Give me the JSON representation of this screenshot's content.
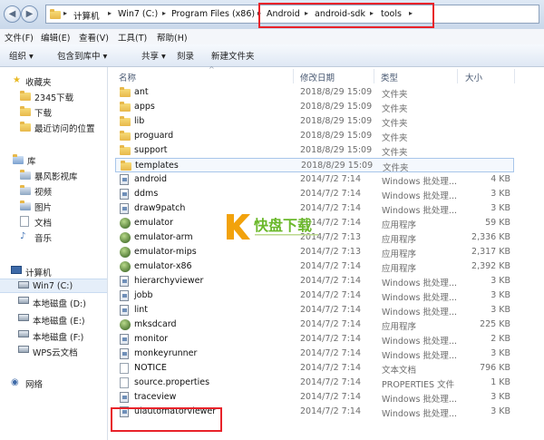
{
  "address": {
    "crumbs": [
      "计算机",
      "Win7 (C:)",
      "Program Files (x86)",
      "Android",
      "android-sdk",
      "tools"
    ]
  },
  "menu": [
    "文件(F)",
    "编辑(E)",
    "查看(V)",
    "工具(T)",
    "帮助(H)"
  ],
  "toolbar": {
    "organize": "组织 ▾",
    "include": "包含到库中 ▾",
    "share": "共享 ▾",
    "burn": "刻录",
    "new_folder": "新建文件夹"
  },
  "nav": {
    "favorites": "收藏夹",
    "fav_items": [
      "2345下载",
      "下载",
      "最近访问的位置"
    ],
    "library": "库",
    "lib_items": [
      "暴风影视库",
      "视频",
      "图片",
      "文档",
      "音乐"
    ],
    "computer": "计算机",
    "drives": [
      "Win7 (C:)",
      "本地磁盘 (D:)",
      "本地磁盘 (E:)",
      "本地磁盘 (F:)",
      "WPS云文档"
    ],
    "network": "网络"
  },
  "columns": {
    "name": "名称",
    "date": "修改日期",
    "type": "类型",
    "size": "大小"
  },
  "files": [
    {
      "name": "ant",
      "date": "2018/8/29 15:09",
      "type": "文件夹",
      "size": "",
      "icon": "folder"
    },
    {
      "name": "apps",
      "date": "2018/8/29 15:09",
      "type": "文件夹",
      "size": "",
      "icon": "folder"
    },
    {
      "name": "lib",
      "date": "2018/8/29 15:09",
      "type": "文件夹",
      "size": "",
      "icon": "folder"
    },
    {
      "name": "proguard",
      "date": "2018/8/29 15:09",
      "type": "文件夹",
      "size": "",
      "icon": "folder"
    },
    {
      "name": "support",
      "date": "2018/8/29 15:09",
      "type": "文件夹",
      "size": "",
      "icon": "folder"
    },
    {
      "name": "templates",
      "date": "2018/8/29 15:09",
      "type": "文件夹",
      "size": "",
      "icon": "folder"
    },
    {
      "name": "android",
      "date": "2014/7/2 7:14",
      "type": "Windows 批处理...",
      "size": "4 KB",
      "icon": "bat"
    },
    {
      "name": "ddms",
      "date": "2014/7/2 7:14",
      "type": "Windows 批处理...",
      "size": "3 KB",
      "icon": "bat"
    },
    {
      "name": "draw9patch",
      "date": "2014/7/2 7:14",
      "type": "Windows 批处理...",
      "size": "3 KB",
      "icon": "bat"
    },
    {
      "name": "emulator",
      "date": "2014/7/2 7:14",
      "type": "应用程序",
      "size": "59 KB",
      "icon": "exe"
    },
    {
      "name": "emulator-arm",
      "date": "2014/7/2 7:13",
      "type": "应用程序",
      "size": "2,336 KB",
      "icon": "exe"
    },
    {
      "name": "emulator-mips",
      "date": "2014/7/2 7:13",
      "type": "应用程序",
      "size": "2,317 KB",
      "icon": "exe"
    },
    {
      "name": "emulator-x86",
      "date": "2014/7/2 7:14",
      "type": "应用程序",
      "size": "2,392 KB",
      "icon": "exe"
    },
    {
      "name": "hierarchyviewer",
      "date": "2014/7/2 7:14",
      "type": "Windows 批处理...",
      "size": "3 KB",
      "icon": "bat"
    },
    {
      "name": "jobb",
      "date": "2014/7/2 7:14",
      "type": "Windows 批处理...",
      "size": "3 KB",
      "icon": "bat"
    },
    {
      "name": "lint",
      "date": "2014/7/2 7:14",
      "type": "Windows 批处理...",
      "size": "3 KB",
      "icon": "bat"
    },
    {
      "name": "mksdcard",
      "date": "2014/7/2 7:14",
      "type": "应用程序",
      "size": "225 KB",
      "icon": "exe"
    },
    {
      "name": "monitor",
      "date": "2014/7/2 7:14",
      "type": "Windows 批处理...",
      "size": "2 KB",
      "icon": "bat"
    },
    {
      "name": "monkeyrunner",
      "date": "2014/7/2 7:14",
      "type": "Windows 批处理...",
      "size": "3 KB",
      "icon": "bat"
    },
    {
      "name": "NOTICE",
      "date": "2014/7/2 7:14",
      "type": "文本文档",
      "size": "796 KB",
      "icon": "doc"
    },
    {
      "name": "source.properties",
      "date": "2014/7/2 7:14",
      "type": "PROPERTIES 文件",
      "size": "1 KB",
      "icon": "doc"
    },
    {
      "name": "traceview",
      "date": "2014/7/2 7:14",
      "type": "Windows 批处理...",
      "size": "3 KB",
      "icon": "bat"
    },
    {
      "name": "uiautomatorviewer",
      "date": "2014/7/2 7:14",
      "type": "Windows 批处理...",
      "size": "3 KB",
      "icon": "bat"
    }
  ],
  "watermark": {
    "brand": "快盘下载"
  }
}
